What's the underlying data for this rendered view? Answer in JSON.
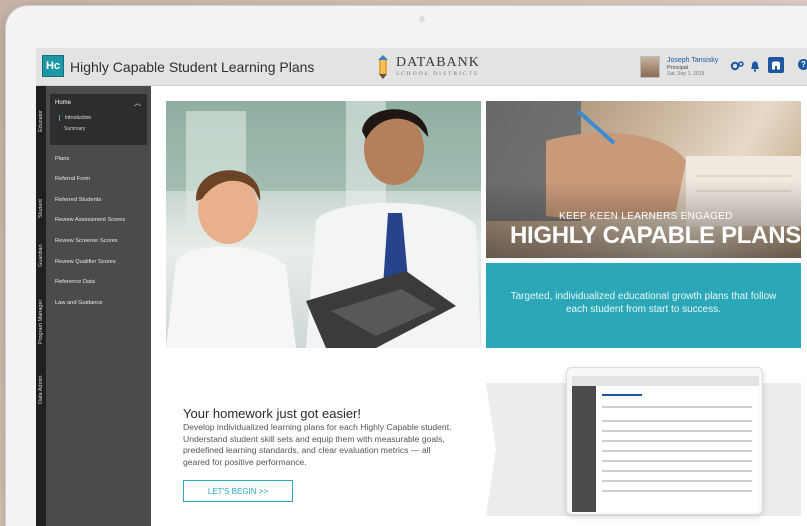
{
  "header": {
    "logo_text": "Hc",
    "app_title": "Highly Capable Student Learning Plans",
    "brand_name": "DATABANK",
    "brand_sub": "SCHOOL DISTRICTS",
    "user_name": "Joseph Tansisky",
    "user_role": "Principal",
    "user_date": "Sat, Sep 1, 2019",
    "icons": [
      "gears-icon",
      "bell-icon",
      "store-icon",
      "help-icon"
    ]
  },
  "rail": {
    "tabs": [
      "Educator",
      "Student",
      "Guardian",
      "Program Manager",
      "Data Admin"
    ]
  },
  "sidebar": {
    "home_label": "Home",
    "home_sub": [
      "Introduction",
      "Summary"
    ],
    "items": [
      "Plans",
      "Referral Form",
      "Referred Students",
      "Review Assessment Scores",
      "Review Screener Scores",
      "Review Qualifier Scores",
      "Reference Data",
      "Law and Guidance"
    ]
  },
  "main": {
    "banner_kicker": "KEEP KEEN LEARNERS ENGAGED",
    "banner_title": "HIGHLY CAPABLE PLANS",
    "teal_text": "Targeted, individualized educational growth plans that follow each student from start to success.",
    "homework_title": "Your homework just got easier!",
    "homework_body": "Develop individualized learning plans for each Highly Capable student. Understand student skill sets and equip them with measurable goals, predefined learning standards, and clear evaluation metrics — all geared for positive performance.",
    "cta_label": "LET'S BEGIN >>"
  },
  "colors": {
    "accent_teal": "#2ba7b8",
    "brand_blue": "#1d57a0",
    "sidebar": "#4b4b4b"
  }
}
